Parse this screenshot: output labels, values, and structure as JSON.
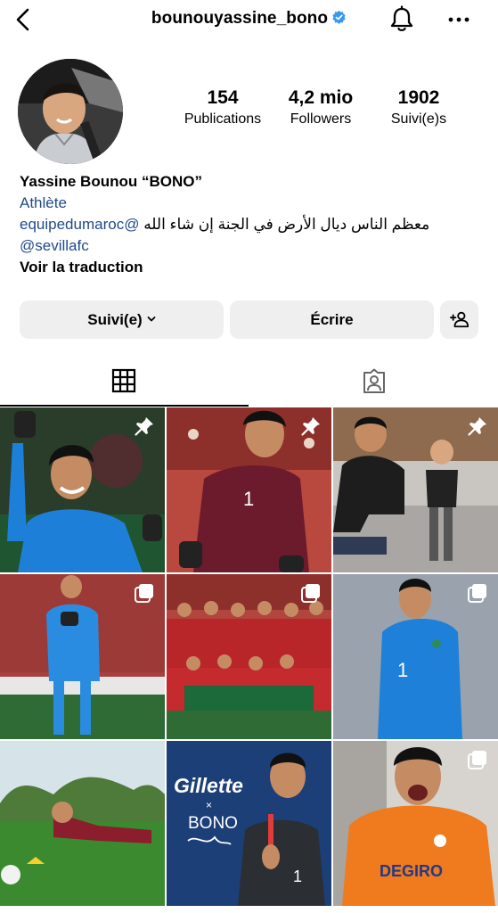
{
  "header": {
    "username": "bounouyassine_bono",
    "verified": true
  },
  "stats": [
    {
      "value": "154",
      "label": "Publications"
    },
    {
      "value": "4,2 mio",
      "label": "Followers"
    },
    {
      "value": "1902",
      "label": "Suivi(e)s"
    }
  ],
  "bio": {
    "name": "Yassine Bounou “BONO”",
    "category": "Athlète",
    "mention1": "equipedumaroc@",
    "arabic": "معظم الناس ديال الأرض في الجنة إن شاء الله",
    "mention2": "@sevillafc",
    "translate": "Voir la traduction"
  },
  "actions": {
    "following_label": "Suivi(e)",
    "message_label": "Écrire"
  },
  "tabs": {
    "active": "grid"
  },
  "posts": [
    {
      "id": "p1",
      "pinned": true,
      "multi": false
    },
    {
      "id": "p2",
      "pinned": true,
      "multi": false
    },
    {
      "id": "p3",
      "pinned": true,
      "multi": false
    },
    {
      "id": "p4",
      "pinned": false,
      "multi": true
    },
    {
      "id": "p5",
      "pinned": false,
      "multi": true
    },
    {
      "id": "p6",
      "pinned": false,
      "multi": true
    },
    {
      "id": "p7",
      "pinned": false,
      "multi": false
    },
    {
      "id": "p8",
      "pinned": false,
      "multi": false,
      "overlay": {
        "brand": "Gillette",
        "x": "×",
        "name": "BONO"
      }
    },
    {
      "id": "p9",
      "pinned": false,
      "multi": true,
      "overlay": {
        "sponsor": "DEGIRO"
      }
    }
  ],
  "colors": {
    "verified": "#3897f0",
    "link": "#1f4b8a",
    "button_bg": "#efefef"
  }
}
